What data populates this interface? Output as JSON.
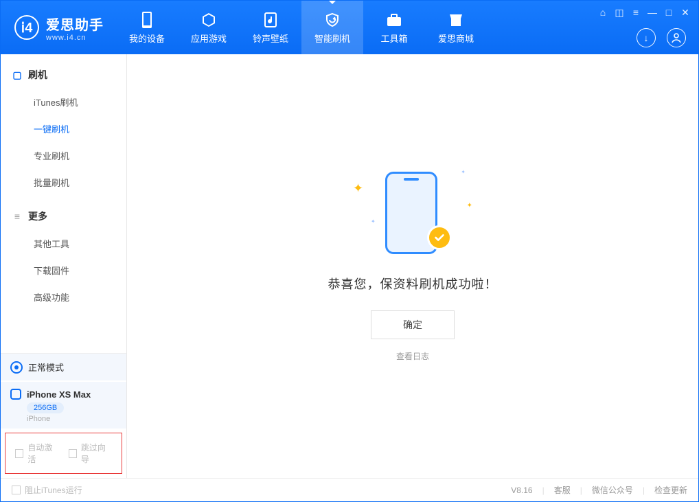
{
  "app": {
    "name": "爱思助手",
    "website": "www.i4.cn"
  },
  "tabs": {
    "device": "我的设备",
    "apps": "应用游戏",
    "ring": "铃声壁纸",
    "flash": "智能刷机",
    "tools": "工具箱",
    "store": "爱思商城"
  },
  "sidebar": {
    "group1_title": "刷机",
    "items1": {
      "itunes": "iTunes刷机",
      "oneclick": "一键刷机",
      "pro": "专业刷机",
      "batch": "批量刷机"
    },
    "group2_title": "更多",
    "items2": {
      "other": "其他工具",
      "firmware": "下载固件",
      "adv": "高级功能"
    }
  },
  "device": {
    "mode": "正常模式",
    "name": "iPhone XS Max",
    "storage": "256GB",
    "type": "iPhone"
  },
  "checks": {
    "auto_activate": "自动激活",
    "skip_guide": "跳过向导"
  },
  "main": {
    "message": "恭喜您，保资料刷机成功啦！",
    "ok": "确定",
    "log": "查看日志"
  },
  "footer": {
    "stop_itunes": "阻止iTunes运行",
    "version": "V8.16",
    "support": "客服",
    "wechat": "微信公众号",
    "update": "检查更新"
  }
}
